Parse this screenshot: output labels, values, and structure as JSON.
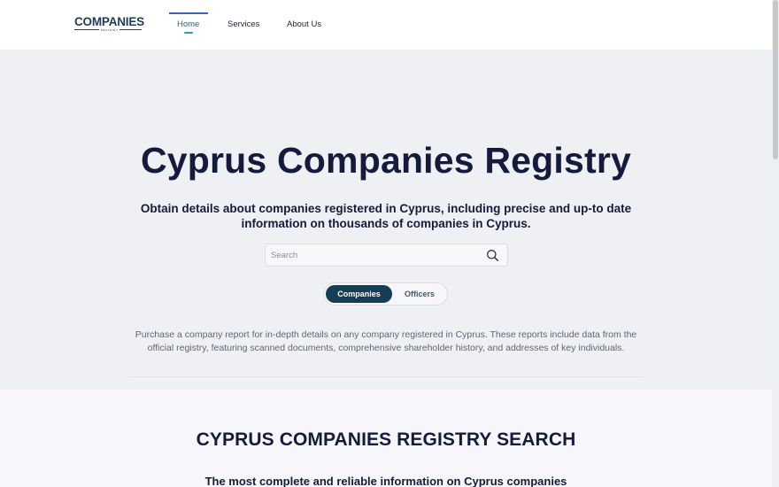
{
  "header": {
    "logo": "COMPANIES",
    "logo_sub": "REGISTRY",
    "nav": [
      {
        "label": "Home",
        "active": true
      },
      {
        "label": "Services"
      },
      {
        "label": "About Us"
      }
    ]
  },
  "hero": {
    "title": "Cyprus Companies Registry",
    "subtitle": "Obtain details about companies registered in Cyprus, including precise and up-to date information on thousands of companies in Cyprus.",
    "search": {
      "placeholder": "Search",
      "value": "",
      "icon": "search-icon"
    },
    "toggle": {
      "selected": "Companies",
      "options": [
        "Companies",
        "Officers"
      ]
    },
    "description": "Purchase a company report for in-depth details on any company registered in Cyprus. These reports include data from the official registry, featuring scanned documents, comprehensive shareholder history, and addresses of key individuals."
  },
  "section": {
    "title": "CYPRUS COMPANIES REGISTRY SEARCH",
    "subtitle": "The most complete and reliable information on Cyprus companies"
  },
  "colors": {
    "accent": "#153e54",
    "nav_active": "#1d6b8a",
    "title": "#141b3c",
    "hero_bg": "#eff0f3"
  }
}
